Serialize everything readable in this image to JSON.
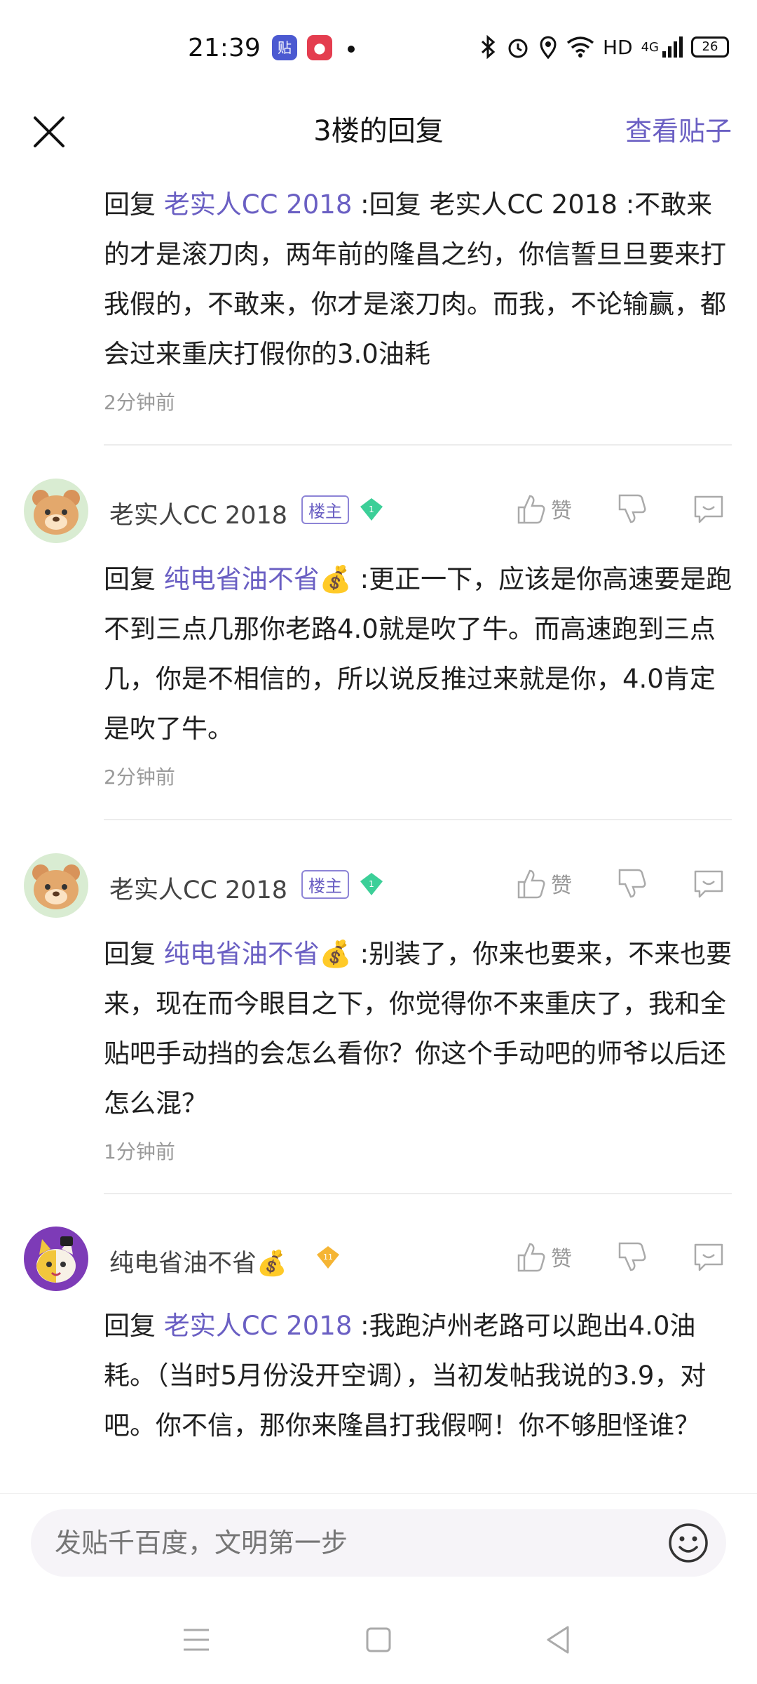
{
  "status_bar": {
    "time": "21:39",
    "badges": [
      {
        "icon": "tieba-app-icon",
        "text": "贴",
        "color": "#4b59d1"
      },
      {
        "icon": "red-app-icon",
        "text": "●",
        "color": "#e43d4f"
      }
    ],
    "network": "HD",
    "signal_type": "4G",
    "battery": "26"
  },
  "header": {
    "title": "3楼的回复",
    "view_post_label": "查看贴子"
  },
  "replies": [
    {
      "prefix": "回复",
      "mention": "老实人CC 2018",
      "text": ":回复 老实人CC 2018 :不敢来的才是滚刀肉，两年前的隆昌之约，你信誓旦旦要来打我假的，不敢来，你才是滚刀肉。而我，不论输赢，都会过来重庆打假你的3.0油耗",
      "time": "2分钟前"
    },
    {
      "username": "老实人CC 2018",
      "owner_badge": "楼主",
      "level_badge": "1",
      "like_label": "赞",
      "prefix": "回复",
      "mention": "纯电省油不省💰",
      "text": ":更正一下，应该是你高速要是跑不到三点几那你老路4.0就是吹了牛。而高速跑到三点几，你是不相信的，所以说反推过来就是你，4.0肯定是吹了牛。",
      "time": "2分钟前"
    },
    {
      "username": "老实人CC 2018",
      "owner_badge": "楼主",
      "level_badge": "1",
      "like_label": "赞",
      "prefix": "回复",
      "mention": "纯电省油不省💰",
      "text": ":别装了，你来也要来，不来也要来，现在而今眼目之下，你觉得你不来重庆了，我和全贴吧手动挡的会怎么看你？你这个手动吧的师爷以后还怎么混？",
      "time": "1分钟前"
    },
    {
      "username": "纯电省油不省💰",
      "level_badge": "11",
      "like_label": "赞",
      "prefix": "回复",
      "mention": "老实人CC 2018",
      "text": ":我跑泸州老路可以跑出4.0油耗。（当时5月份没开空调），当初发帖我说的3.9，对吧。你不信，那你来隆昌打我假啊！你不够胆怪谁？"
    }
  ],
  "input": {
    "placeholder": "发贴千百度，文明第一步"
  },
  "colors": {
    "accent": "#6a5fc3",
    "muted": "#9a9a9a",
    "teal_badge": "#3ccf98",
    "gold_badge": "#f5b534"
  }
}
